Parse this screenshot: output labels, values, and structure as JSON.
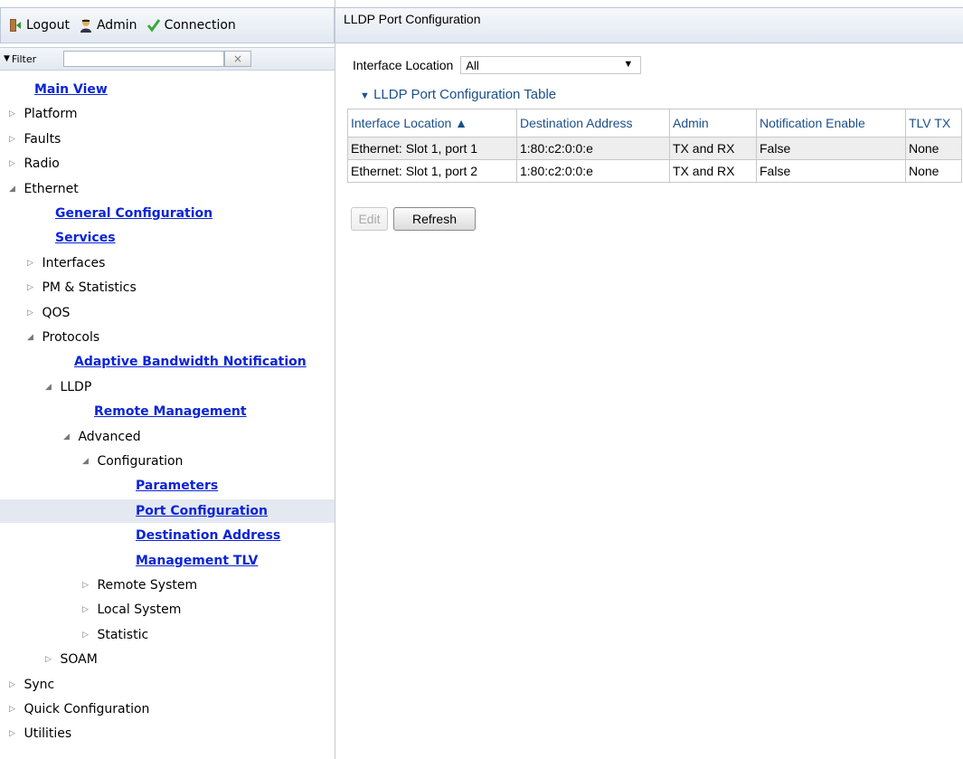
{
  "topbar": {
    "logout": "Logout",
    "admin": "Admin",
    "connection": "Connection"
  },
  "filter": {
    "label": "Filter",
    "value": "",
    "clear": "×"
  },
  "tree": [
    {
      "label": "Main View",
      "type": "link",
      "indent": 0,
      "arrow": ""
    },
    {
      "label": "Platform",
      "type": "plain",
      "indent": 0,
      "arrow": "collapsed"
    },
    {
      "label": "Faults",
      "type": "plain",
      "indent": 0,
      "arrow": "collapsed"
    },
    {
      "label": "Radio",
      "type": "plain",
      "indent": 0,
      "arrow": "collapsed"
    },
    {
      "label": "Ethernet",
      "type": "plain",
      "indent": 0,
      "arrow": "expanded"
    },
    {
      "label": "General Configuration",
      "type": "link",
      "indent": 1,
      "arrow": ""
    },
    {
      "label": "Services",
      "type": "link",
      "indent": 1,
      "arrow": ""
    },
    {
      "label": "Interfaces",
      "type": "plain",
      "indent": 1,
      "arrow": "collapsed"
    },
    {
      "label": "PM & Statistics",
      "type": "plain",
      "indent": 1,
      "arrow": "collapsed"
    },
    {
      "label": "QOS",
      "type": "plain",
      "indent": 1,
      "arrow": "collapsed"
    },
    {
      "label": "Protocols",
      "type": "plain",
      "indent": 1,
      "arrow": "expanded"
    },
    {
      "label": "Adaptive Bandwidth Notification",
      "type": "link",
      "indent": 2,
      "arrow": ""
    },
    {
      "label": "LLDP",
      "type": "plain",
      "indent": 2,
      "arrow": "expanded"
    },
    {
      "label": "Remote Management",
      "type": "link",
      "indent": 3,
      "arrow": ""
    },
    {
      "label": "Advanced",
      "type": "plain",
      "indent": 3,
      "arrow": "expanded"
    },
    {
      "label": "Configuration",
      "type": "plain",
      "indent": 4,
      "arrow": "expanded"
    },
    {
      "label": "Parameters",
      "type": "link",
      "indent": 5,
      "arrow": ""
    },
    {
      "label": "Port Configuration",
      "type": "link",
      "indent": 5,
      "arrow": "",
      "selected": true
    },
    {
      "label": "Destination Address",
      "type": "link",
      "indent": 5,
      "arrow": ""
    },
    {
      "label": "Management TLV",
      "type": "link",
      "indent": 5,
      "arrow": ""
    },
    {
      "label": "Remote System",
      "type": "plain",
      "indent": 4,
      "arrow": "collapsed"
    },
    {
      "label": "Local System",
      "type": "plain",
      "indent": 4,
      "arrow": "collapsed"
    },
    {
      "label": "Statistic",
      "type": "plain",
      "indent": 4,
      "arrow": "collapsed"
    },
    {
      "label": "SOAM",
      "type": "plain",
      "indent": 2,
      "arrow": "collapsed"
    },
    {
      "label": "Sync",
      "type": "plain",
      "indent": 0,
      "arrow": "collapsed"
    },
    {
      "label": "Quick Configuration",
      "type": "plain",
      "indent": 0,
      "arrow": "collapsed"
    },
    {
      "label": "Utilities",
      "type": "plain",
      "indent": 0,
      "arrow": "collapsed"
    }
  ],
  "main": {
    "title": "LLDP Port Configuration",
    "interface_location_label": "Interface Location",
    "interface_location_value": "All",
    "section_title": "LLDP Port Configuration Table",
    "columns": [
      "Interface Location ▲",
      "Destination Address",
      "Admin",
      "Notification Enable",
      "TLV TX"
    ],
    "rows": [
      [
        "Ethernet: Slot 1, port 1",
        "1:80:c2:0:0:e",
        "TX and RX",
        "False",
        "None"
      ],
      [
        "Ethernet: Slot 1, port 2",
        "1:80:c2:0:0:e",
        "TX and RX",
        "False",
        "None"
      ]
    ],
    "edit_label": "Edit",
    "refresh_label": "Refresh"
  }
}
